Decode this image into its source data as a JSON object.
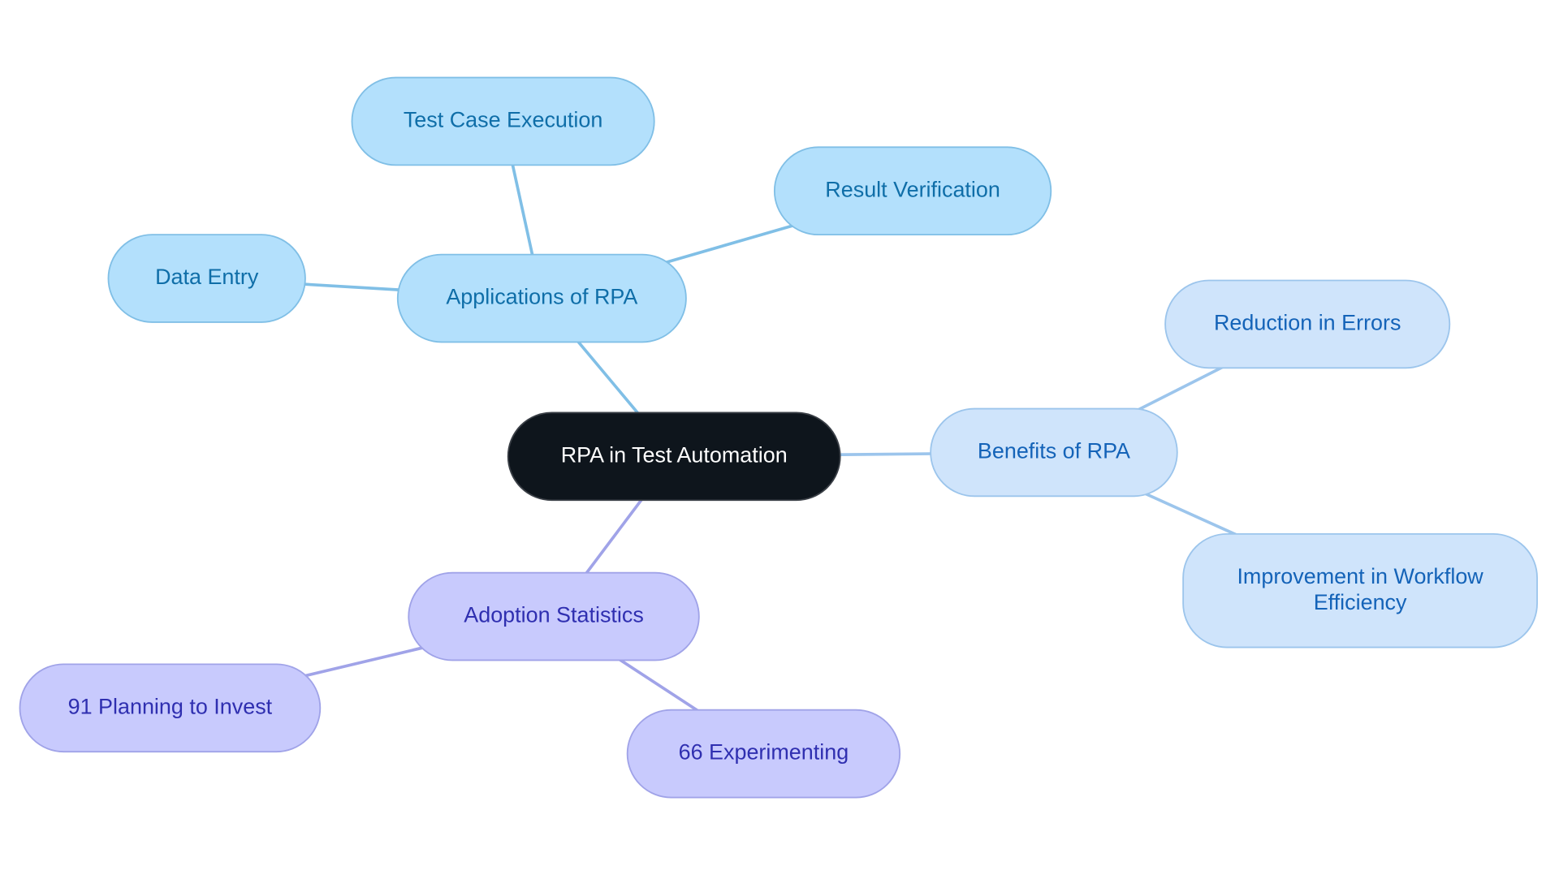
{
  "diagram": {
    "type": "mindmap",
    "root": {
      "id": "root",
      "label": "RPA in Test Automation"
    },
    "branches": [
      {
        "id": "applications",
        "label": "Applications of RPA",
        "theme": {
          "fill": "#b3e0fc",
          "stroke": "#80bfe6",
          "text": "#0f6ea8",
          "edge": "#80bfe6"
        },
        "children": [
          {
            "id": "test-case-execution",
            "label": "Test Case Execution"
          },
          {
            "id": "result-verification",
            "label": "Result Verification"
          },
          {
            "id": "data-entry",
            "label": "Data Entry"
          }
        ]
      },
      {
        "id": "benefits",
        "label": "Benefits of RPA",
        "theme": {
          "fill": "#cfe4fb",
          "stroke": "#9cc5ec",
          "text": "#1463b8",
          "edge": "#9cc5ec"
        },
        "children": [
          {
            "id": "reduction-errors",
            "label": "Reduction in Errors"
          },
          {
            "id": "workflow-efficiency",
            "label": "Improvement in Workflow Efficiency",
            "lines": [
              "Improvement in Workflow",
              "Efficiency"
            ]
          }
        ]
      },
      {
        "id": "adoption",
        "label": "Adoption Statistics",
        "theme": {
          "fill": "#c8cafd",
          "stroke": "#a0a3e8",
          "text": "#2f2fb0",
          "edge": "#a0a3e8"
        },
        "children": [
          {
            "id": "planning-invest",
            "label": "91 Planning to Invest"
          },
          {
            "id": "experimenting",
            "label": "66 Experimenting"
          }
        ]
      }
    ],
    "root_theme": {
      "fill": "#0e151c",
      "stroke": "#3a3f46",
      "text": "#ffffff"
    }
  }
}
